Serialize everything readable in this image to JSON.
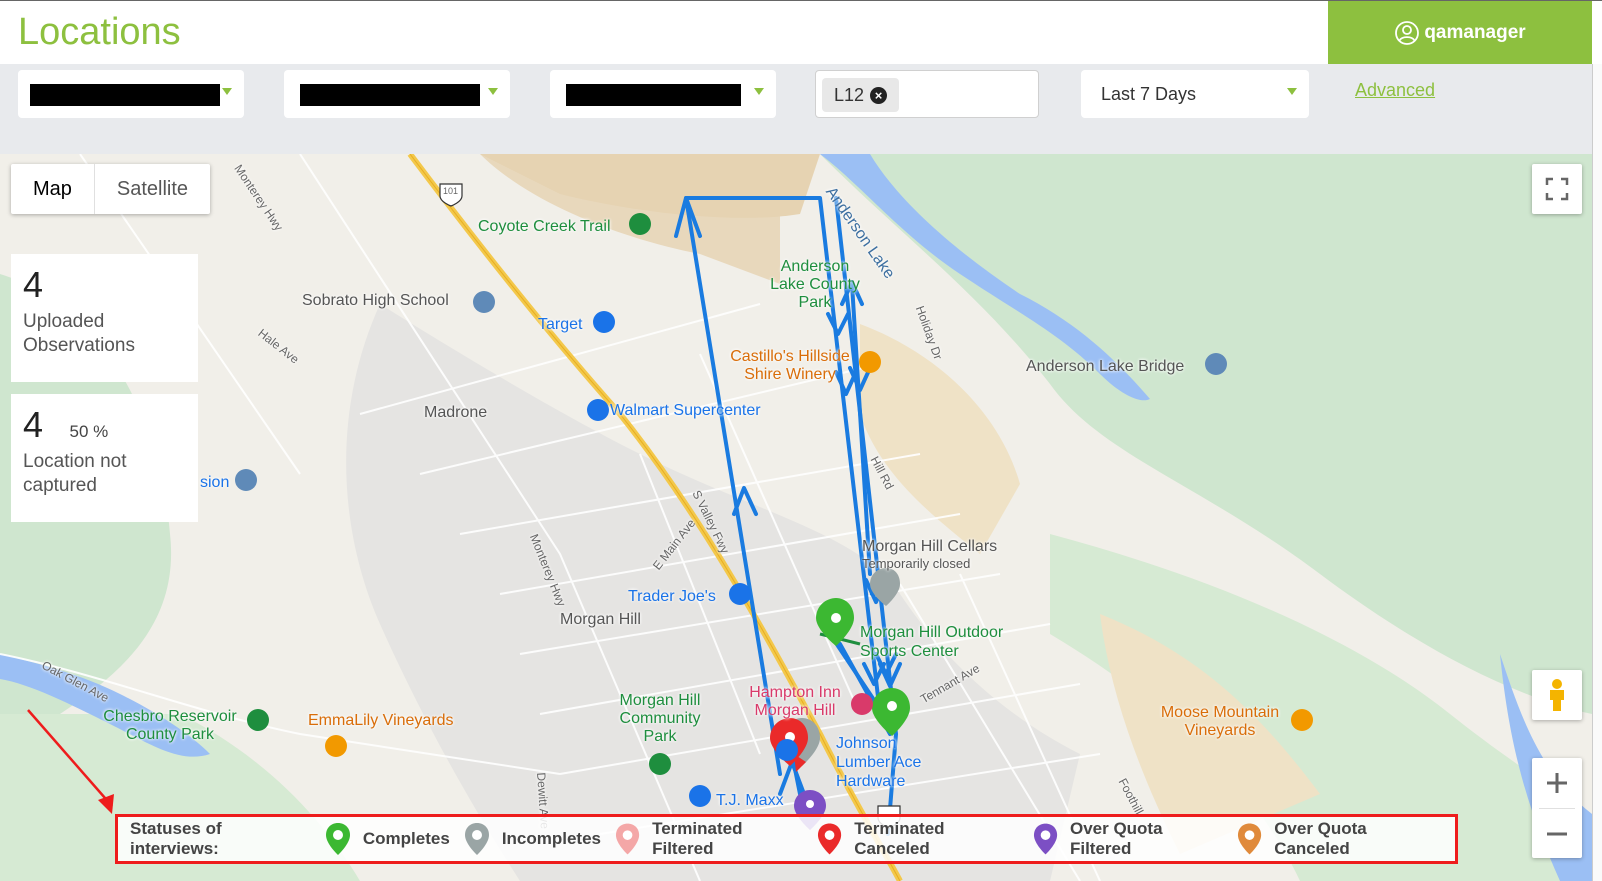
{
  "header": {
    "title": "Locations",
    "user": "qamanager"
  },
  "filters": {
    "dropdown_1": "",
    "dropdown_2": "",
    "dropdown_3": "",
    "tag": "L12",
    "date_range": "Last 7 Days",
    "advanced_label": "Advanced"
  },
  "map": {
    "map_type": [
      "Map",
      "Satellite"
    ],
    "active_map_type": "Map",
    "labels": {
      "coyote_creek_trail": "Coyote Creek Trail",
      "anderson_lake": "Anderson Lake",
      "anderson_lake_county_park": "Anderson Lake County Park",
      "sobrato_high_school": "Sobrato High School",
      "target": "Target",
      "castillos": "Castillo's Hillside Shire Winery",
      "anderson_lake_bridge": "Anderson Lake Bridge",
      "madrone": "Madrone",
      "walmart": "Walmart Supercenter",
      "morgan_hill_cellars": "Morgan Hill Cellars",
      "temporarily_closed": "Temporarily closed",
      "trader_joes": "Trader Joe's",
      "morgan_hill": "Morgan Hill",
      "outdoor_sports": "Morgan Hill Outdoor Sports Center",
      "hampton_inn": "Hampton Inn Morgan Hill",
      "morgan_hill_park": "Morgan Hill Community Park",
      "johnson_lumber": "Johnson Lumber Ace Hardware",
      "moose_mountain": "Moose Mountain Vineyards",
      "chesbro": "Chesbro Reservoir County Park",
      "emmalily": "EmmaLily Vineyards",
      "tj_maxx": "T.J. Maxx",
      "sion": "sion",
      "hwy_101": "101",
      "monterey_hwy": "Monterey Hwy",
      "hale_ave": "Hale Ave",
      "holiday_dr": "Holiday Dr",
      "s_valley_fwy": "S Valley Fwy",
      "e_main_ave": "E Main Ave",
      "tennant_ave": "Tennant Ave",
      "oak_glen_ave": "Oak Glen Ave",
      "dewitt_ave": "Dewitt Ave",
      "foothill": "Foothill",
      "hill_rd": "Hill Rd"
    }
  },
  "stats": {
    "uploaded_count": "4",
    "uploaded_label": "Uploaded Observations",
    "not_captured_count": "4",
    "not_captured_pct": "50 %",
    "not_captured_label": "Location not captured"
  },
  "legend": {
    "title": "Statuses of interviews:",
    "items": [
      {
        "label": "Completes",
        "color": "#3cb832"
      },
      {
        "label": "Incompletes",
        "color": "#9aa5a5"
      },
      {
        "label": "Terminated Filtered",
        "color": "#f4a7a7"
      },
      {
        "label": "Terminated Canceled",
        "color": "#ea2a2a"
      },
      {
        "label": "Over Quota Filtered",
        "color": "#7c4fc4"
      },
      {
        "label": "Over Quota Canceled",
        "color": "#e08a3b"
      }
    ]
  },
  "colors": {
    "brand_green": "#8dc03f",
    "route_blue": "#1a7be0",
    "annotation_red": "#ee1c1c"
  },
  "icons": {
    "user": "user-circle-icon",
    "fullscreen": "fullscreen-icon",
    "pegman": "pegman-icon",
    "zoom_in": "plus-icon",
    "zoom_out": "minus-icon"
  }
}
